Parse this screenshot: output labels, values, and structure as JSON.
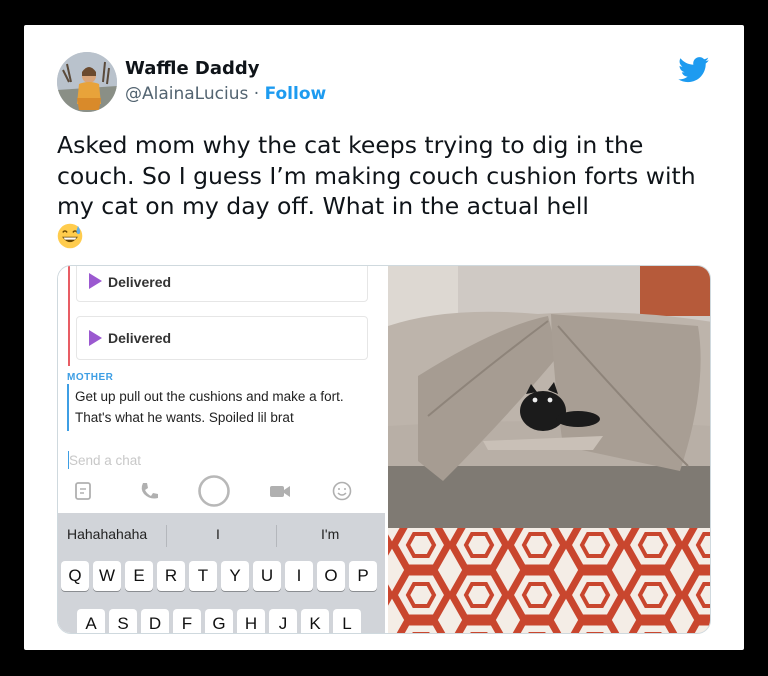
{
  "tweet": {
    "display_name": "Waffle Daddy",
    "handle": "@AlainaLucius",
    "separator": " · ",
    "follow_label": "Follow",
    "text": "Asked mom why the cat keeps trying to dig in the couch. So I guess I’m making couch cushion forts with my cat on my day off. What in the actual hell"
  },
  "screenshot": {
    "messages": [
      {
        "status": "Delivered"
      },
      {
        "status": "Delivered"
      }
    ],
    "sender_label": "MOTHER",
    "message": "Get up pull out the cushions and make a fort. That's what he wants.  Spoiled lil brat",
    "input_placeholder": "Send a chat",
    "suggestions": [
      "Hahahahaha",
      "I",
      "I'm"
    ],
    "keys_row1": [
      "Q",
      "W",
      "E",
      "R",
      "T",
      "Y",
      "U",
      "I",
      "O",
      "P"
    ],
    "keys_row2": [
      "A",
      "S",
      "D",
      "F",
      "G",
      "H",
      "J",
      "K",
      "L"
    ]
  },
  "colors": {
    "twitter_blue": "#1d9bf0",
    "delivered_arrow": "#9b59d0",
    "mother_blue": "#3d9ee4",
    "sent_bar": "#e85d64"
  },
  "icons": [
    "twitter-bird-icon",
    "grin-sweat-emoji",
    "sticker-icon",
    "phone-icon",
    "capture-button",
    "video-icon",
    "smiley-icon"
  ]
}
